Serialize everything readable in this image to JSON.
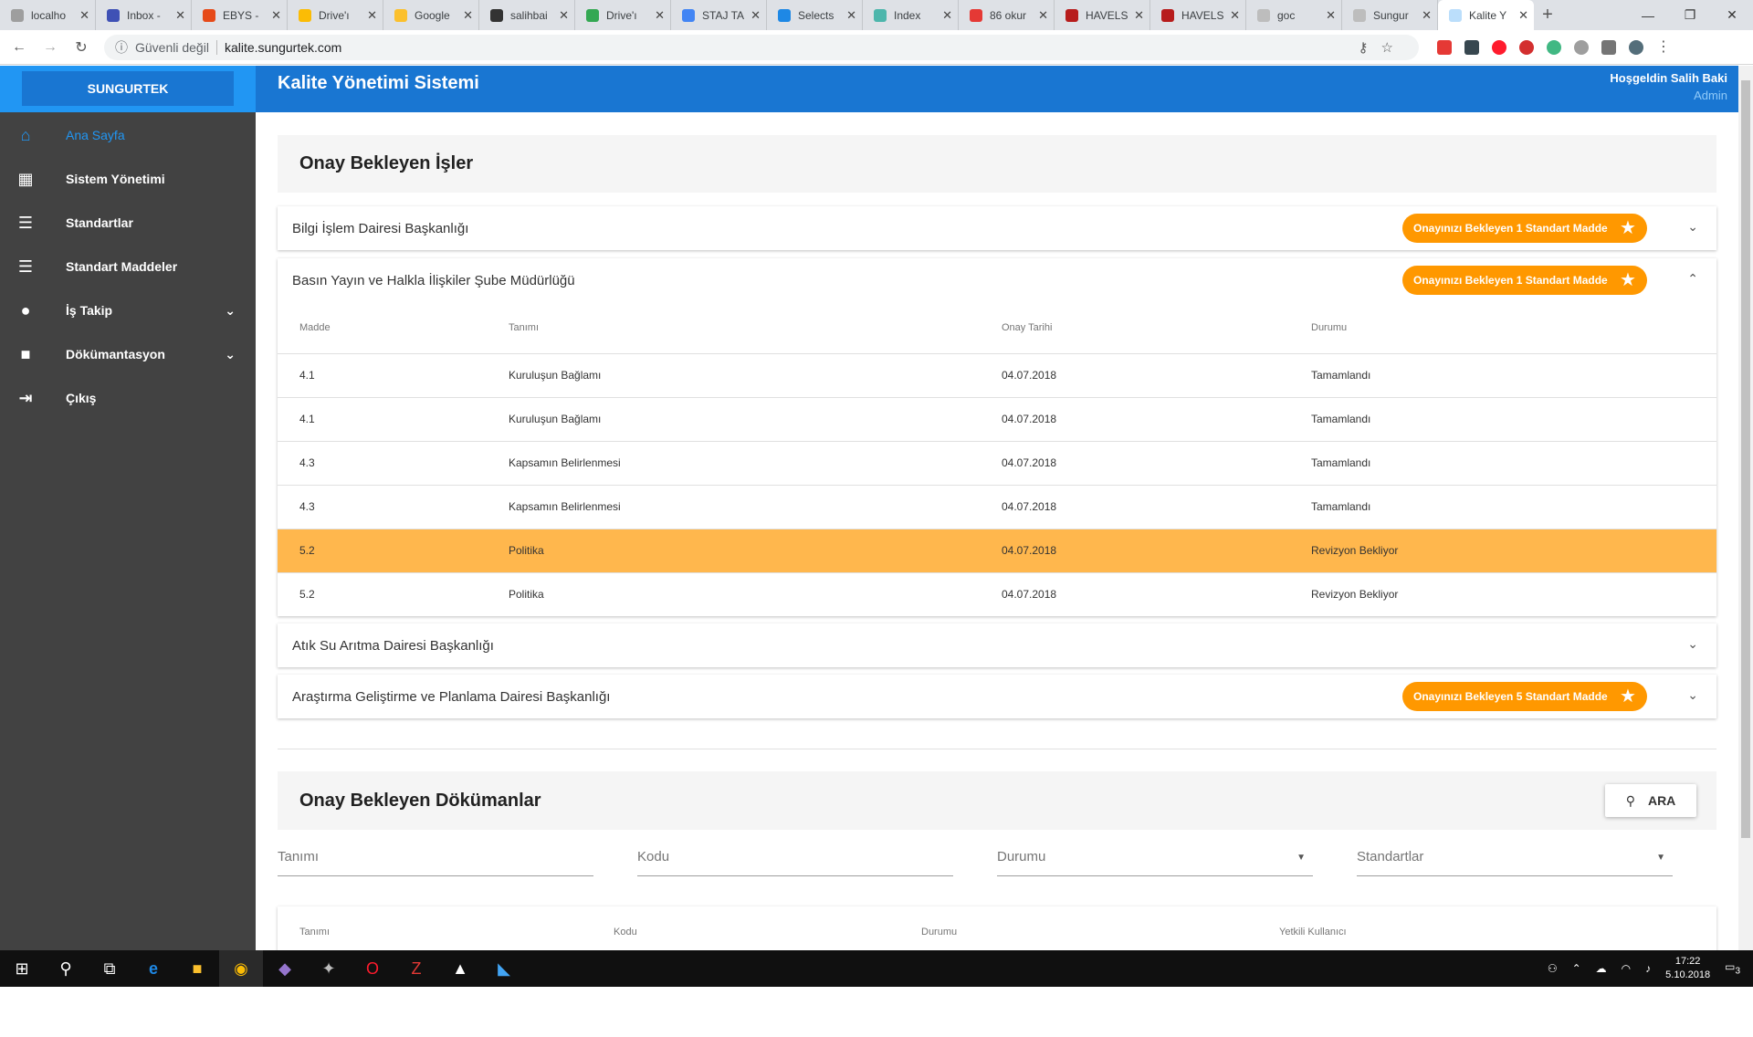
{
  "browser": {
    "tabs": [
      {
        "label": "localho",
        "color": "#9e9e9e"
      },
      {
        "label": "Inbox -",
        "color": "#3f51b5"
      },
      {
        "label": "EBYS -",
        "color": "#e64a19"
      },
      {
        "label": "Drive'ı",
        "color": "#fbbc05"
      },
      {
        "label": "Google",
        "color": "#fbc02d"
      },
      {
        "label": "salihbai",
        "color": "#333333"
      },
      {
        "label": "Drive'ı",
        "color": "#34a853"
      },
      {
        "label": "STAJ TA",
        "color": "#4285f4"
      },
      {
        "label": "Selects",
        "color": "#1e88e5"
      },
      {
        "label": "Index",
        "color": "#4db6ac"
      },
      {
        "label": "86 okur",
        "color": "#e53935"
      },
      {
        "label": "HAVELS",
        "color": "#b71c1c"
      },
      {
        "label": "HAVELS",
        "color": "#b71c1c"
      },
      {
        "label": "goc",
        "color": "#bdbdbd"
      },
      {
        "label": "Sungur",
        "color": "#bdbdbd"
      },
      {
        "label": "Kalite Y",
        "color": "#bbdefb"
      }
    ],
    "security": "Güvenli değil",
    "url": "kalite.sungurtek.com"
  },
  "brand": "SUNGURTEK",
  "header": {
    "title": "Kalite Yönetimi Sistemi",
    "greeting": "Hoşgeldin Salih Baki",
    "role": "Admin"
  },
  "sidebar": {
    "items": [
      {
        "label": "Ana Sayfa",
        "icon": "home-icon"
      },
      {
        "label": "Sistem Yönetimi",
        "icon": "dashboard-icon"
      },
      {
        "label": "Standartlar",
        "icon": "list-icon"
      },
      {
        "label": "Standart Maddeler",
        "icon": "list-icon"
      },
      {
        "label": "İş Takip",
        "icon": "account-icon"
      },
      {
        "label": "Dökümantasyon",
        "icon": "folder-icon"
      },
      {
        "label": "Çıkış",
        "icon": "exit-icon"
      }
    ]
  },
  "pending_jobs": {
    "title": "Onay Bekleyen İşler",
    "panels": [
      {
        "name": "Bilgi İşlem Dairesi Başkanlığı",
        "badge": "Onayınızı Bekleyen 1 Standart Madde"
      },
      {
        "name": "Basın Yayın ve Halkla İlişkiler Şube Müdürlüğü",
        "badge": "Onayınızı Bekleyen 1 Standart Madde"
      },
      {
        "name": "Atık Su Arıtma Dairesi Başkanlığı",
        "badge": ""
      },
      {
        "name": "Araştırma Geliştirme ve Planlama Dairesi Başkanlığı",
        "badge": "Onayınızı Bekleyen 5 Standart Madde"
      }
    ],
    "table": {
      "headers": [
        "Madde",
        "Tanımı",
        "Onay Tarihi",
        "Durumu"
      ],
      "rows": [
        [
          "4.1",
          "Kuruluşun Bağlamı",
          "04.07.2018",
          "Tamamlandı"
        ],
        [
          "4.1",
          "Kuruluşun Bağlamı",
          "04.07.2018",
          "Tamamlandı"
        ],
        [
          "4.3",
          "Kapsamın Belirlenmesi",
          "04.07.2018",
          "Tamamlandı"
        ],
        [
          "4.3",
          "Kapsamın Belirlenmesi",
          "04.07.2018",
          "Tamamlandı"
        ],
        [
          "5.2",
          "Politika",
          "04.07.2018",
          "Revizyon Bekliyor"
        ],
        [
          "5.2",
          "Politika",
          "04.07.2018",
          "Revizyon Bekliyor"
        ]
      ]
    }
  },
  "pending_docs": {
    "title": "Onay Bekleyen Dökümanlar",
    "search_label": "ARA",
    "filters": {
      "name": "Tanımı",
      "code": "Kodu",
      "status": "Durumu",
      "standards": "Standartlar"
    },
    "table_headers": [
      "Tanımı",
      "Kodu",
      "Durumu",
      "Yetkili Kullanıcı"
    ]
  },
  "taskbar": {
    "time": "17:22",
    "date": "5.10.2018",
    "notifications": "3"
  }
}
